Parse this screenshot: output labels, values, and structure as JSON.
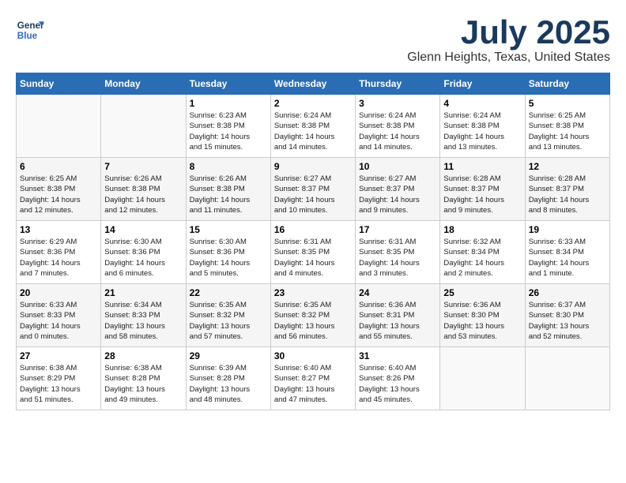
{
  "header": {
    "logo_line1": "General",
    "logo_line2": "Blue",
    "month": "July 2025",
    "location": "Glenn Heights, Texas, United States"
  },
  "days_of_week": [
    "Sunday",
    "Monday",
    "Tuesday",
    "Wednesday",
    "Thursday",
    "Friday",
    "Saturday"
  ],
  "weeks": [
    [
      {
        "day": "",
        "detail": ""
      },
      {
        "day": "",
        "detail": ""
      },
      {
        "day": "1",
        "detail": "Sunrise: 6:23 AM\nSunset: 8:38 PM\nDaylight: 14 hours\nand 15 minutes."
      },
      {
        "day": "2",
        "detail": "Sunrise: 6:24 AM\nSunset: 8:38 PM\nDaylight: 14 hours\nand 14 minutes."
      },
      {
        "day": "3",
        "detail": "Sunrise: 6:24 AM\nSunset: 8:38 PM\nDaylight: 14 hours\nand 14 minutes."
      },
      {
        "day": "4",
        "detail": "Sunrise: 6:24 AM\nSunset: 8:38 PM\nDaylight: 14 hours\nand 13 minutes."
      },
      {
        "day": "5",
        "detail": "Sunrise: 6:25 AM\nSunset: 8:38 PM\nDaylight: 14 hours\nand 13 minutes."
      }
    ],
    [
      {
        "day": "6",
        "detail": "Sunrise: 6:25 AM\nSunset: 8:38 PM\nDaylight: 14 hours\nand 12 minutes."
      },
      {
        "day": "7",
        "detail": "Sunrise: 6:26 AM\nSunset: 8:38 PM\nDaylight: 14 hours\nand 12 minutes."
      },
      {
        "day": "8",
        "detail": "Sunrise: 6:26 AM\nSunset: 8:38 PM\nDaylight: 14 hours\nand 11 minutes."
      },
      {
        "day": "9",
        "detail": "Sunrise: 6:27 AM\nSunset: 8:37 PM\nDaylight: 14 hours\nand 10 minutes."
      },
      {
        "day": "10",
        "detail": "Sunrise: 6:27 AM\nSunset: 8:37 PM\nDaylight: 14 hours\nand 9 minutes."
      },
      {
        "day": "11",
        "detail": "Sunrise: 6:28 AM\nSunset: 8:37 PM\nDaylight: 14 hours\nand 9 minutes."
      },
      {
        "day": "12",
        "detail": "Sunrise: 6:28 AM\nSunset: 8:37 PM\nDaylight: 14 hours\nand 8 minutes."
      }
    ],
    [
      {
        "day": "13",
        "detail": "Sunrise: 6:29 AM\nSunset: 8:36 PM\nDaylight: 14 hours\nand 7 minutes."
      },
      {
        "day": "14",
        "detail": "Sunrise: 6:30 AM\nSunset: 8:36 PM\nDaylight: 14 hours\nand 6 minutes."
      },
      {
        "day": "15",
        "detail": "Sunrise: 6:30 AM\nSunset: 8:36 PM\nDaylight: 14 hours\nand 5 minutes."
      },
      {
        "day": "16",
        "detail": "Sunrise: 6:31 AM\nSunset: 8:35 PM\nDaylight: 14 hours\nand 4 minutes."
      },
      {
        "day": "17",
        "detail": "Sunrise: 6:31 AM\nSunset: 8:35 PM\nDaylight: 14 hours\nand 3 minutes."
      },
      {
        "day": "18",
        "detail": "Sunrise: 6:32 AM\nSunset: 8:34 PM\nDaylight: 14 hours\nand 2 minutes."
      },
      {
        "day": "19",
        "detail": "Sunrise: 6:33 AM\nSunset: 8:34 PM\nDaylight: 14 hours\nand 1 minute."
      }
    ],
    [
      {
        "day": "20",
        "detail": "Sunrise: 6:33 AM\nSunset: 8:33 PM\nDaylight: 14 hours\nand 0 minutes."
      },
      {
        "day": "21",
        "detail": "Sunrise: 6:34 AM\nSunset: 8:33 PM\nDaylight: 13 hours\nand 58 minutes."
      },
      {
        "day": "22",
        "detail": "Sunrise: 6:35 AM\nSunset: 8:32 PM\nDaylight: 13 hours\nand 57 minutes."
      },
      {
        "day": "23",
        "detail": "Sunrise: 6:35 AM\nSunset: 8:32 PM\nDaylight: 13 hours\nand 56 minutes."
      },
      {
        "day": "24",
        "detail": "Sunrise: 6:36 AM\nSunset: 8:31 PM\nDaylight: 13 hours\nand 55 minutes."
      },
      {
        "day": "25",
        "detail": "Sunrise: 6:36 AM\nSunset: 8:30 PM\nDaylight: 13 hours\nand 53 minutes."
      },
      {
        "day": "26",
        "detail": "Sunrise: 6:37 AM\nSunset: 8:30 PM\nDaylight: 13 hours\nand 52 minutes."
      }
    ],
    [
      {
        "day": "27",
        "detail": "Sunrise: 6:38 AM\nSunset: 8:29 PM\nDaylight: 13 hours\nand 51 minutes."
      },
      {
        "day": "28",
        "detail": "Sunrise: 6:38 AM\nSunset: 8:28 PM\nDaylight: 13 hours\nand 49 minutes."
      },
      {
        "day": "29",
        "detail": "Sunrise: 6:39 AM\nSunset: 8:28 PM\nDaylight: 13 hours\nand 48 minutes."
      },
      {
        "day": "30",
        "detail": "Sunrise: 6:40 AM\nSunset: 8:27 PM\nDaylight: 13 hours\nand 47 minutes."
      },
      {
        "day": "31",
        "detail": "Sunrise: 6:40 AM\nSunset: 8:26 PM\nDaylight: 13 hours\nand 45 minutes."
      },
      {
        "day": "",
        "detail": ""
      },
      {
        "day": "",
        "detail": ""
      }
    ]
  ]
}
